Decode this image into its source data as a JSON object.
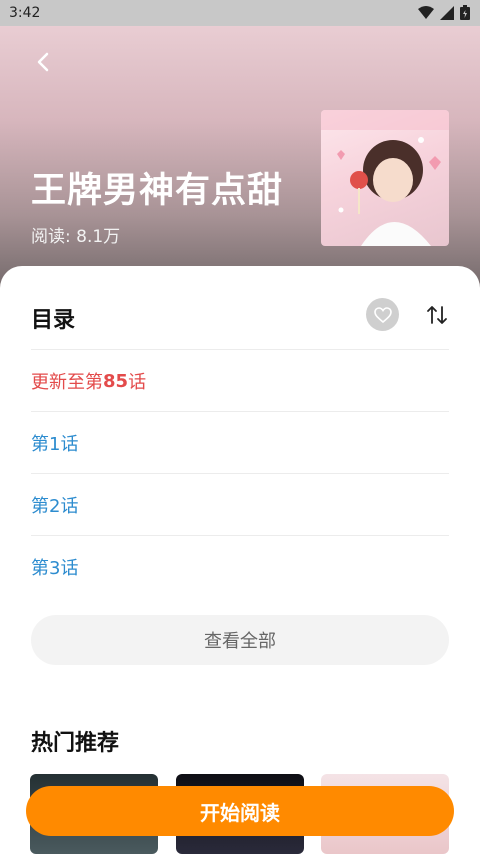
{
  "status_bar": {
    "time": "3:42"
  },
  "book": {
    "title": "王牌男神有点甜",
    "reads": "阅读: 8.1万"
  },
  "toc": {
    "heading": "目录",
    "update_prefix": "更新至第",
    "update_number": "85",
    "update_suffix": "话",
    "chapters": [
      "第1话",
      "第2话",
      "第3话"
    ],
    "view_all": "查看全部"
  },
  "recommend": {
    "heading": "热门推荐"
  },
  "cta": {
    "start_reading": "开始阅读"
  },
  "colors": {
    "accent": "#ff8a00",
    "chapter_link": "#2d8ccf",
    "update": "#e34b4b"
  }
}
